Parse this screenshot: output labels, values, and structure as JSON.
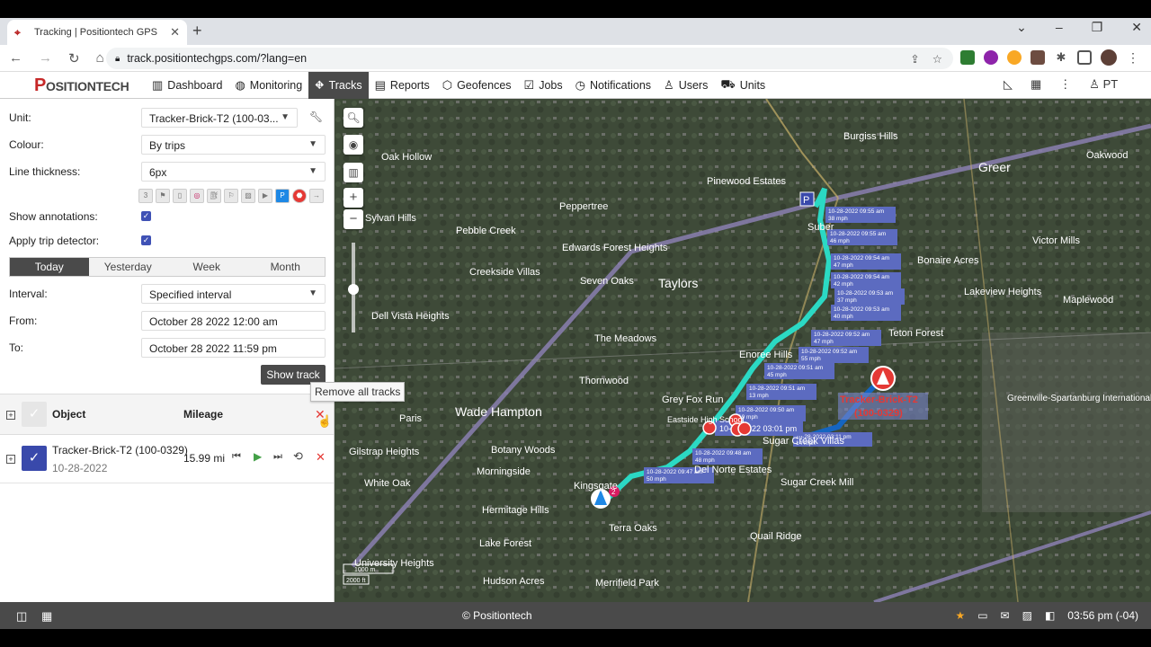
{
  "browser": {
    "tab_title": "Tracking | Positiontech GPS",
    "url": "track.positiontechgps.com/?lang=en",
    "new_tab": "+",
    "close_tab": "✕"
  },
  "app": {
    "logo": "POSITIONTECH",
    "logo_initial": "P",
    "logo_rest": "OSITIONTECH",
    "menu": [
      {
        "label": "Dashboard",
        "icon": "chart-icon"
      },
      {
        "label": "Monitoring",
        "icon": "globe-icon"
      },
      {
        "label": "Tracks",
        "icon": "tracks-icon",
        "active": true
      },
      {
        "label": "Reports",
        "icon": "report-icon"
      },
      {
        "label": "Geofences",
        "icon": "geofence-icon"
      },
      {
        "label": "Jobs",
        "icon": "jobs-icon"
      },
      {
        "label": "Notifications",
        "icon": "bell-icon"
      },
      {
        "label": "Users",
        "icon": "user-icon"
      },
      {
        "label": "Units",
        "icon": "truck-icon"
      }
    ],
    "user_short": "PT"
  },
  "panel": {
    "unit_label": "Unit:",
    "unit_value": "Tracker-Brick-T2 (100-03...",
    "colour_label": "Colour:",
    "colour_value": "By trips",
    "thickness_label": "Line thickness:",
    "thickness_value": "6px",
    "annotations_label": "Show annotations:",
    "trip_detector_label": "Apply trip detector:",
    "period_tabs": [
      "Today",
      "Yesterday",
      "Week",
      "Month"
    ],
    "interval_label": "Interval:",
    "interval_value": "Specified interval",
    "from_label": "From:",
    "from_value": "October 28 2022 12:00 am",
    "to_label": "To:",
    "to_value": "October 28 2022 11:59 pm",
    "show_track": "Show track",
    "tooltip": "Remove all tracks",
    "col_object": "Object",
    "col_mileage": "Mileage",
    "track": {
      "name": "Tracker-Brick-T2 (100-0329)",
      "date": "10-28-2022",
      "mileage": "15.99 mi"
    }
  },
  "map": {
    "places": [
      "Oak Hollow",
      "Sylvan Hills",
      "Pebble Creek",
      "Peppertree",
      "Edwards Forest Heights",
      "Creekside Villas",
      "Seven Oaks",
      "Taylors",
      "Dell Vista Heights",
      "The Meadows",
      "Thornwood",
      "Wade Hampton",
      "Paris",
      "Gilstrap Heights",
      "Botany Woods",
      "Morningside",
      "White Oak",
      "Kingsgate",
      "Hermitage Hills",
      "Lake Forest",
      "Terra Oaks",
      "University Heights",
      "Hudson Acres",
      "Merrifield Park",
      "Quail Ridge",
      "Sugar Creek Mill",
      "Sugar Creek Villas",
      "Enoree Hills",
      "Grey Fox Run",
      "Eastside High School",
      "Pinewood Estates",
      "Burgiss Hills",
      "Greer",
      "Oakwood",
      "Victor Mills",
      "Bonaire Acres",
      "Lakeview Heights",
      "Maplewood",
      "Teton Forest",
      "Greenville-Spartanburg International Airport",
      "Suber",
      "Del Norte Estates"
    ],
    "unit_label_line1": "Tracker-Brick-T2",
    "unit_label_line2": "(100-0329)",
    "route_color": "#2bd9c4",
    "route2_color": "#1565c0",
    "annotations": [
      {
        "t": "10-28-2022 09:55 am",
        "s": "38 mph"
      },
      {
        "t": "10-28-2022 09:55 am",
        "s": "46 mph"
      },
      {
        "t": "10-28-2022 09:54 am",
        "s": "47 mph"
      },
      {
        "t": "10-28-2022 09:54 am",
        "s": "42 mph"
      },
      {
        "t": "10-28-2022 09:53 am",
        "s": "37 mph"
      },
      {
        "t": "10-28-2022 09:53 am",
        "s": "40 mph"
      },
      {
        "t": "10-28-2022 09:52 am",
        "s": "47 mph"
      },
      {
        "t": "10-28-2022 09:52 am",
        "s": "55 mph"
      },
      {
        "t": "10-28-2022 09:51 am",
        "s": "45 mph"
      },
      {
        "t": "10-28-2022 09:51 am",
        "s": "13 mph"
      },
      {
        "t": "10-28-2022 09:50 am",
        "s": "19 mph"
      },
      {
        "t": "10-28-2022 09:48 am",
        "s": "48 mph"
      },
      {
        "t": "10-28-2022 09:47 am",
        "s": "50 mph"
      },
      {
        "t": "10-28-2022 03:11 pm",
        "s": "14 mph"
      },
      {
        "t": "10-28-2022 03:01 pm",
        "s": ""
      }
    ],
    "scale_1": "1000 m",
    "scale_2": "2000 ft",
    "parking": "P",
    "start_badge": "2"
  },
  "status": {
    "copyright": "© Positiontech",
    "time": "03:56 pm (-04)"
  }
}
